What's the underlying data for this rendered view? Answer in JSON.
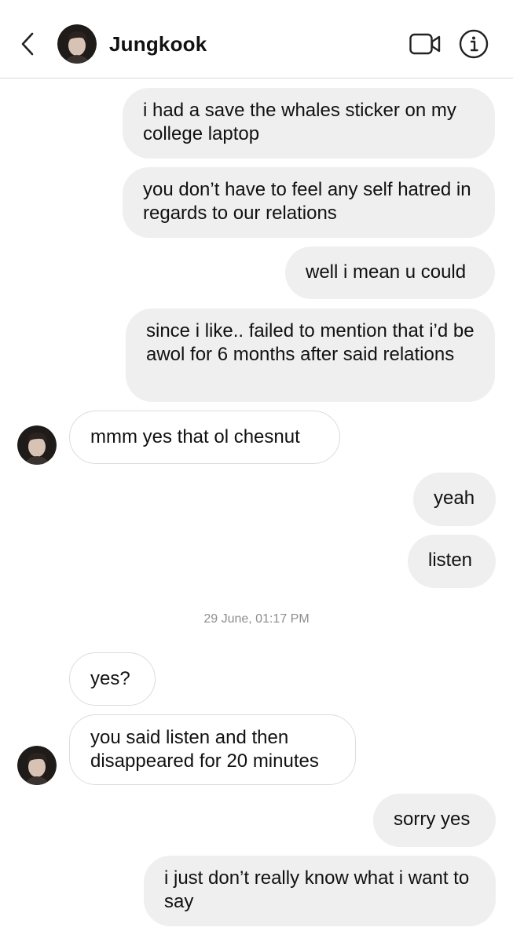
{
  "header": {
    "contact_name": "Jungkook",
    "back_icon": "chevron-left-icon",
    "video_icon": "video-camera-icon",
    "info_icon": "info-circle-icon"
  },
  "colors": {
    "outgoing_bubble": "#efefef",
    "incoming_border": "#dcdcdc",
    "timestamp_text": "#8e8e8e"
  },
  "messages": [
    {
      "direction": "outgoing",
      "text": "i had a save the whales sticker on my college laptop"
    },
    {
      "direction": "outgoing",
      "text": "you don’t have to feel any self hatred in regards to our relations"
    },
    {
      "direction": "outgoing",
      "text": "well i mean u could"
    },
    {
      "direction": "outgoing",
      "text": "since i like.. failed to mention that i’d be awol for 6 months after said relations"
    },
    {
      "direction": "incoming",
      "text": "mmm yes that ol chesnut"
    },
    {
      "direction": "outgoing",
      "text": "yeah"
    },
    {
      "direction": "outgoing",
      "text": "listen"
    },
    {
      "direction": "incoming",
      "text": "yes?"
    },
    {
      "direction": "incoming",
      "text": "you said listen and then disappeared for 20 minutes"
    },
    {
      "direction": "outgoing",
      "text": "sorry yes"
    },
    {
      "direction": "outgoing",
      "text": "i just don’t really know what i want to say"
    }
  ],
  "timestamp": "29 June, 01:17 PM"
}
